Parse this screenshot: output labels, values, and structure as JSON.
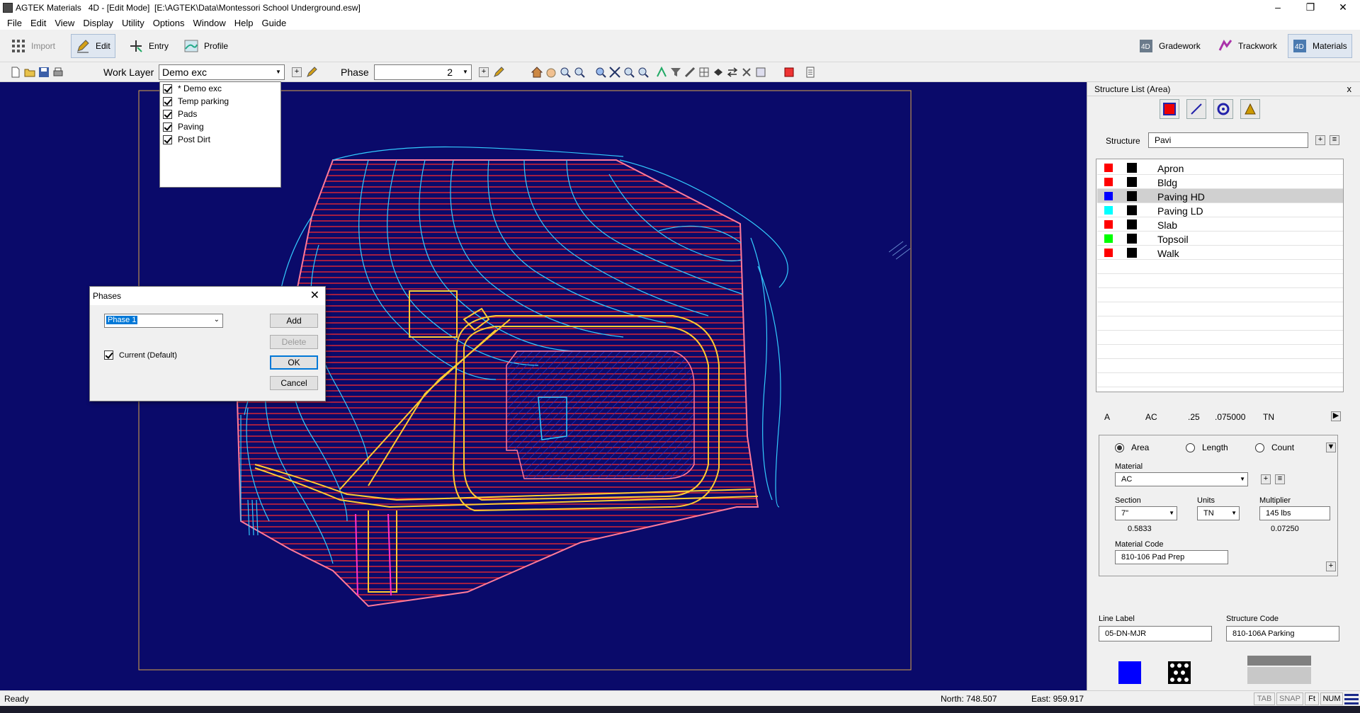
{
  "window": {
    "title": "AGTEK Materials   4D - [Edit Mode]  [E:\\AGTEK\\Data\\Montessori School Underground.esw]",
    "controls": [
      "–",
      "❐",
      "✕"
    ]
  },
  "menu": [
    "File",
    "Edit",
    "View",
    "Display",
    "Utility",
    "Options",
    "Window",
    "Help",
    "Guide"
  ],
  "toolbar": {
    "import_label": "Import",
    "edit_label": "Edit",
    "entry_label": "Entry",
    "profile_label": "Profile",
    "gradework_label": "Gradework",
    "trackwork_label": "Trackwork",
    "materials_label": "Materials"
  },
  "layerbar": {
    "work_layer_label": "Work Layer",
    "work_layer_value": "Demo exc",
    "phase_label": "Phase",
    "phase_value": "2"
  },
  "layer_dropdown": [
    {
      "label": "* Demo exc",
      "checked": true
    },
    {
      "label": "Temp parking",
      "checked": true
    },
    {
      "label": "Pads",
      "checked": true
    },
    {
      "label": "Paving",
      "checked": true
    },
    {
      "label": "Post Dirt",
      "checked": true
    }
  ],
  "phases_dialog": {
    "title": "Phases",
    "selected_phase": "Phase 1",
    "current_label": "Current (Default)",
    "current_checked": true,
    "add_label": "Add",
    "delete_label": "Delete",
    "ok_label": "OK",
    "cancel_label": "Cancel"
  },
  "structure_panel": {
    "title": "Structure List (Area)",
    "structure_label": "Structure",
    "structure_value": "Pavi",
    "items": [
      {
        "name": "Apron",
        "color": "#ff0000",
        "selected": false
      },
      {
        "name": "Bldg",
        "color": "#ff0000",
        "selected": false
      },
      {
        "name": "Paving HD",
        "color": "#0000ff",
        "selected": true
      },
      {
        "name": "Paving LD",
        "color": "#00ffff",
        "selected": false
      },
      {
        "name": "Slab",
        "color": "#ff0000",
        "selected": false
      },
      {
        "name": "Topsoil",
        "color": "#00ff00",
        "selected": false
      },
      {
        "name": "Walk",
        "color": "#ff0000",
        "selected": false
      }
    ],
    "summary": {
      "type": "A",
      "material": "AC",
      "section": ".25",
      "multiplier": ".075000",
      "units": "TN"
    },
    "mode": {
      "area_label": "Area",
      "length_label": "Length",
      "count_label": "Count",
      "selected": "Area"
    },
    "material_label": "Material",
    "material_value": "AC",
    "section_label": "Section",
    "section_value": "7\"",
    "section_sub": "0.5833",
    "units_label": "Units",
    "units_value": "TN",
    "multiplier_label": "Multiplier",
    "multiplier_value": "145 lbs",
    "multiplier_sub": "0.07250",
    "material_code_label": "Material Code",
    "material_code_value": "810-106 Pad  Prep",
    "line_label_label": "Line Label",
    "line_label_value": "05-DN-MJR",
    "structure_code_label": "Structure Code",
    "structure_code_value": "810-106A Parking",
    "preview_color": "#0000ff"
  },
  "status": {
    "ready": "Ready",
    "north": "North: 748.507",
    "east": "East: 959.917",
    "indicators": [
      "TAB",
      "SNAP",
      "Ft",
      "NUM"
    ]
  },
  "colors": {
    "canvas_bg": "#0a0a6a",
    "hatch_red": "#ff2a2a",
    "contour_cyan": "#33ccff",
    "outline_pink": "#ff7a9a",
    "paving_yellow": "#ffcc33",
    "hatch_blue": "#2233cc"
  }
}
